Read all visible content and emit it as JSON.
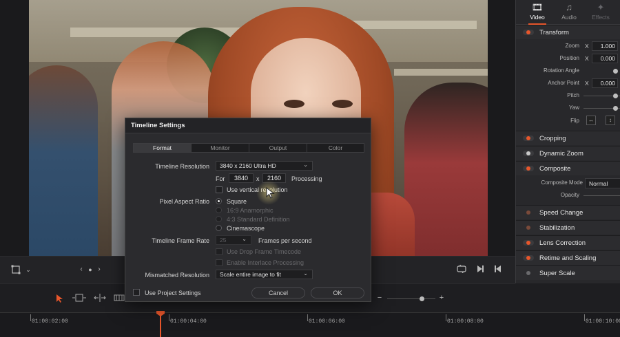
{
  "inspector": {
    "tabs": [
      {
        "label": "Video",
        "icon": "film-icon",
        "active": true
      },
      {
        "label": "Audio",
        "icon": "music-note-icon",
        "active": false
      },
      {
        "label": "Effects",
        "icon": "magic-wand-icon",
        "active": false
      }
    ],
    "transform": {
      "title": "Transform",
      "zoom_label": "Zoom",
      "zoom_axis": "X",
      "zoom_value": "1.000",
      "position_label": "Position",
      "position_axis": "X",
      "position_value": "0.000",
      "rotation_label": "Rotation Angle",
      "anchor_label": "Anchor Point",
      "anchor_axis": "X",
      "anchor_value": "0.000",
      "pitch_label": "Pitch",
      "yaw_label": "Yaw",
      "flip_label": "Flip"
    },
    "sections": {
      "cropping": "Cropping",
      "dynamic_zoom": "Dynamic Zoom",
      "composite": "Composite",
      "composite_mode_label": "Composite Mode",
      "composite_mode_value": "Normal",
      "opacity_label": "Opacity",
      "speed_change": "Speed Change",
      "stabilization": "Stabilization",
      "lens_correction": "Lens Correction",
      "retime": "Retime and Scaling",
      "super_scale": "Super Scale"
    }
  },
  "dialog": {
    "title": "Timeline Settings",
    "tabs": [
      "Format",
      "Monitor",
      "Output",
      "Color"
    ],
    "active_tab": "Format",
    "resolution_label": "Timeline Resolution",
    "resolution_value": "3840 x 2160 Ultra HD",
    "for_label": "For",
    "width_value": "3840",
    "x_label": "x",
    "height_value": "2160",
    "processing_label": "Processing",
    "vertical_label": "Use vertical resolution",
    "par_label": "Pixel Aspect Ratio",
    "par_options": [
      "Square",
      "16:9 Anamorphic",
      "4:3 Standard Definition",
      "Cinemascope"
    ],
    "par_selected": "Square",
    "frame_rate_label": "Timeline Frame Rate",
    "frame_rate_value": "25",
    "fps_label": "Frames per second",
    "drop_frame_label": "Use Drop Frame Timecode",
    "interlace_label": "Enable Interlace Processing",
    "mismatch_label": "Mismatched Resolution",
    "mismatch_value": "Scale entire image to fit",
    "use_project_label": "Use Project Settings",
    "cancel_label": "Cancel",
    "ok_label": "OK"
  },
  "timeline": {
    "timecodes": [
      "01:00:02:00",
      "01:00:04:00",
      "01:00:06:00",
      "01:00:08:00",
      "01:00:10:00"
    ]
  },
  "colors": {
    "accent": "#e8562b",
    "panel": "#28282b",
    "dialog": "#2b2b2e"
  }
}
